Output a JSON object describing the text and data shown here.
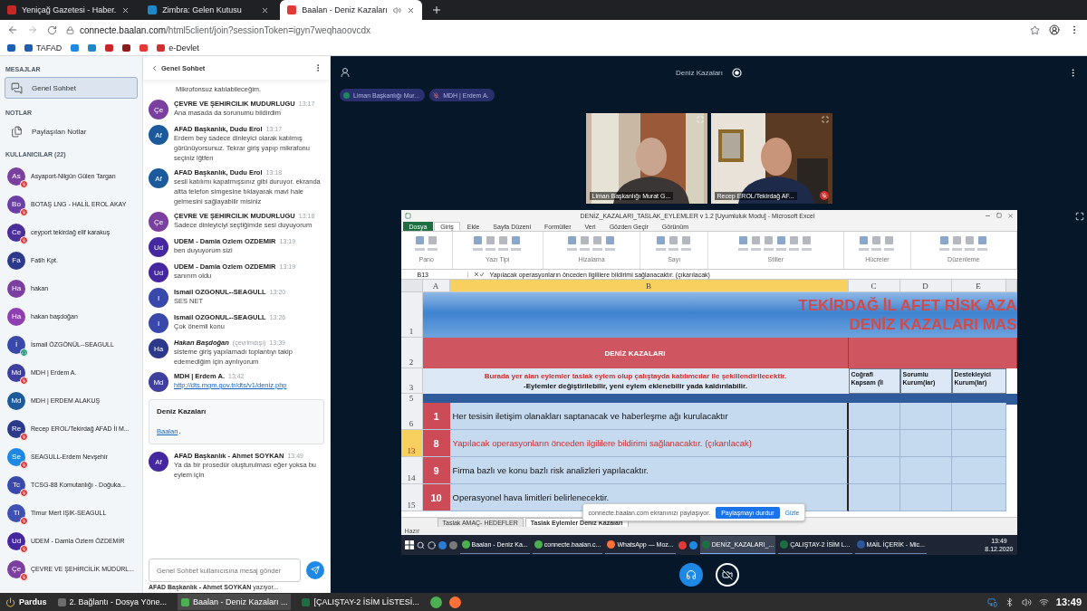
{
  "browser": {
    "tabs": [
      {
        "title": "Yeniçağ Gazetesi - Haber.",
        "color": "#c62828",
        "selected": false,
        "audible": false
      },
      {
        "title": "Zimbra: Gelen Kutusu",
        "color": "#1e88c8",
        "selected": false,
        "audible": false
      },
      {
        "title": "Baalan - Deniz Kazaları",
        "color": "#e53935",
        "selected": true,
        "audible": true
      }
    ],
    "url_host": "connecte.baalan.com",
    "url_path": "/html5client/join?sessionToken=igyn7weqhaoovcdx",
    "bookmarks": [
      {
        "kind": "icon",
        "color": "#1e5fb4"
      },
      {
        "kind": "labeled",
        "label": "TAFAD",
        "color": "#1e5fb4"
      },
      {
        "kind": "icon",
        "color": "#1e88e5"
      },
      {
        "kind": "icon",
        "color": "#1e88c8"
      },
      {
        "kind": "icon",
        "color": "#c62828"
      },
      {
        "kind": "icon",
        "color": "#8e1b1b"
      },
      {
        "kind": "icon",
        "color": "#e53935"
      },
      {
        "kind": "labeled",
        "label": "e-Devlet",
        "color": "#d32f2f"
      }
    ]
  },
  "sidebar": {
    "messages_label": "MESAJLAR",
    "chat_item": {
      "label": "Genel Sohbet",
      "selected": true
    },
    "notes_label": "NOTLAR",
    "notes_item": {
      "label": "Paylaşılan Notlar"
    },
    "users_label": "KULLANICILAR (22)",
    "users": [
      {
        "initials": "As",
        "color": "#7b3fa0",
        "name": "Asyaport-Nilgün Gülen Targan",
        "muted": true,
        "listen_only": false
      },
      {
        "initials": "Bo",
        "color": "#6a3fa6",
        "name": "BOTAŞ LNG - HALİL EROL AKAY",
        "muted": true,
        "listen_only": false
      },
      {
        "initials": "Ce",
        "color": "#4a2f9a",
        "name": "ceyport tekirdağ elif karakuş",
        "muted": true,
        "listen_only": false
      },
      {
        "initials": "Fa",
        "color": "#2d3a8c",
        "name": "Fatih Kpt.",
        "muted": false,
        "listen_only": false
      },
      {
        "initials": "Ha",
        "color": "#7b3fa0",
        "name": "hakan",
        "muted": false,
        "listen_only": false
      },
      {
        "initials": "Ha",
        "color": "#8e3fb0",
        "name": "hakan başdoğan",
        "muted": false,
        "listen_only": false
      },
      {
        "initials": "İ",
        "color": "#3949ab",
        "name": "İsmail ÖZGÖNÜL--SEAGULL",
        "muted": false,
        "listen_only": true
      },
      {
        "initials": "Md",
        "color": "#3f3fa0",
        "name": "MDH | Erdem A.",
        "muted": true,
        "listen_only": false
      },
      {
        "initials": "Md",
        "color": "#1c5a9c",
        "name": "MDH | ERDEM ALAKUŞ",
        "muted": false,
        "listen_only": false
      },
      {
        "initials": "Re",
        "color": "#2c3a8c",
        "name": "Recep EROL/Tekirdağ AFAD İl M...",
        "muted": true,
        "listen_only": false
      },
      {
        "initials": "Se",
        "color": "#1e88e5",
        "name": "SEAGULL-Erdem Nevşehir",
        "muted": true,
        "listen_only": false
      },
      {
        "initials": "Tc",
        "color": "#3949ab",
        "name": "TCSG-88 Komutanlığı - Doğuka...",
        "muted": true,
        "listen_only": false
      },
      {
        "initials": "Ti",
        "color": "#3f51b5",
        "name": "Timur Mert IŞIK-SEAGULL",
        "muted": true,
        "listen_only": false
      },
      {
        "initials": "Ud",
        "color": "#4527a0",
        "name": "UDEM - Damla Özlem ÖZDEMİR",
        "muted": true,
        "listen_only": false
      },
      {
        "initials": "Çe",
        "color": "#7b3fa0",
        "name": "ÇEVRE VE ŞEHİRCİLİK MÜDÜRL...",
        "muted": true,
        "listen_only": false
      }
    ]
  },
  "chat": {
    "title": "Genel Sohbet",
    "messages": [
      {
        "kind": "continued",
        "text": "Mikrofonsuz katılabileceğim."
      },
      {
        "kind": "text",
        "initials": "Çe",
        "color": "#7b3fa0",
        "sender": "ÇEVRE VE ŞEHIRCILIK MUDURLUGU",
        "time": "13:17",
        "text": "Ana masada da sorunumu bildirdim"
      },
      {
        "kind": "text",
        "initials": "Af",
        "color": "#1c5a9c",
        "sender": "AFAD Başkanlık, Dudu Erol",
        "time": "13:17",
        "text": "Erdem bey sadece dinleyici olarak katılmış görünüyorsunuz. Tekrar giriş yapıp mikrafonu seçiniz lğtfen"
      },
      {
        "kind": "text",
        "initials": "Af",
        "color": "#1c5a9c",
        "sender": "AFAD Başkanlık, Dudu Erol",
        "time": "13:18",
        "text": "sesli katılımı kapatmışsınız gibi duruyor. ekranda altta telefon simgesine tıklayarak mavi hale gelmesini sağlayabilir misiniz"
      },
      {
        "kind": "text",
        "initials": "Çe",
        "color": "#7b3fa0",
        "sender": "ÇEVRE VE ŞEHIRCILIK MUDURLUGU",
        "time": "13:18",
        "text": "Sadece dinleyiciyi seçtiğimde sesi duyuyorum"
      },
      {
        "kind": "text",
        "initials": "Ud",
        "color": "#4527a0",
        "sender": "UDEM - Damla Ozlem OZDEMIR",
        "time": "13:19",
        "text": "ben duyuyorum sizi"
      },
      {
        "kind": "text",
        "initials": "Ud",
        "color": "#4527a0",
        "sender": "UDEM - Damla Ozlem OZDEMIR",
        "time": "13:19",
        "text": "sanırım oldu"
      },
      {
        "kind": "text",
        "initials": "I",
        "color": "#3949ab",
        "sender": "Ismail OZGONUL--SEAGULL",
        "time": "13:20",
        "text": "SES NET"
      },
      {
        "kind": "text",
        "initials": "I",
        "color": "#3949ab",
        "sender": "Ismail OZGONUL--SEAGULL",
        "time": "13:26",
        "text": "Çok önemli konu"
      },
      {
        "kind": "text",
        "initials": "Ha",
        "color": "#2d3a8c",
        "sender": "Hakan Başdoğan",
        "offline": true,
        "status": "(çevrimdışı)",
        "time": "13:39",
        "text": "sisteme giriş yapılamadı toplantıyı takip edemediğim için ayrılıyorum"
      },
      {
        "kind": "link",
        "initials": "Md",
        "color": "#3f3fa0",
        "sender": "MDH | Erdem A.",
        "time": "13:42",
        "text": "http://dts.mgm.gov.tr/dts/v1/deniz.php"
      },
      {
        "kind": "card",
        "title": "Deniz Kazaları",
        "link": "Baalan",
        "suffix": "."
      },
      {
        "kind": "text",
        "initials": "Af",
        "color": "#4527a0",
        "sender": "AFAD Başkanlık - Ahmet SOYKAN",
        "time": "13:49",
        "text": "Ya da bir prosedür oluşturulması eğer yoksa bu eylem için"
      }
    ],
    "input_placeholder": "Genel Sohbet kullanıcısına mesaj gönder",
    "typing": "**AFAD Başkanlık - Ahmet SOYKAN** yazıyor..."
  },
  "meeting": {
    "title": "Deniz Kazaları",
    "recording": true,
    "talkers": [
      {
        "name": "Liman Başkanlığı Mur...",
        "talking": true
      },
      {
        "name": "MDH | Erdem A.",
        "talking": false
      }
    ],
    "videos": [
      {
        "name": "Liman Başkanlığı Murat G...",
        "muted": false
      },
      {
        "name": "Recep EROL/Tekirdağ AF...",
        "muted": true
      }
    ],
    "controls": [
      {
        "kind": "audio",
        "active": true
      },
      {
        "kind": "video",
        "active": false
      }
    ]
  },
  "excel": {
    "title": "DENİZ_KAZALARI_TASLAK_EYLEMLER v 1.2  [Uyumluluk Modu]  -  Microsoft Excel",
    "menu_tabs": [
      {
        "label": "Dosya",
        "kind": "file",
        "selected": false
      },
      {
        "label": "Giriş",
        "kind": "tab",
        "selected": true
      },
      {
        "label": "Ekle",
        "kind": "tab",
        "selected": false
      },
      {
        "label": "Sayfa Düzeni",
        "kind": "tab",
        "selected": false
      },
      {
        "label": "Formüller",
        "kind": "tab",
        "selected": false
      },
      {
        "label": "Veri",
        "kind": "tab",
        "selected": false
      },
      {
        "label": "Gözden Geçir",
        "kind": "tab",
        "selected": false
      },
      {
        "label": "Görünüm",
        "kind": "tab",
        "selected": false
      }
    ],
    "ribbon_groups": [
      {
        "label": "Pano"
      },
      {
        "label": "Yazı Tipi"
      },
      {
        "label": "Hizalama"
      },
      {
        "label": "Sayı"
      },
      {
        "label": "Stiller"
      },
      {
        "label": "Hücreler"
      },
      {
        "label": "Düzenleme"
      }
    ],
    "name_box": "B13",
    "formula": "Yapılacak operasyonların önceden ilgililere bildirimi sağlanacaktır. (çıkarılacak)",
    "columns": [
      {
        "label": "A",
        "selected": false
      },
      {
        "label": "B",
        "selected": true
      },
      {
        "label": "C",
        "selected": false
      },
      {
        "label": "D",
        "selected": false
      },
      {
        "label": "E",
        "selected": false
      }
    ],
    "rows": [
      {
        "kind": "title",
        "number": "1",
        "lines": [
          "TEKİRDAĞ İL AFET RİSK AZA",
          "DENİZ KAZALARI MAS"
        ]
      },
      {
        "kind": "section",
        "number": "2",
        "text": "DENİZ KAZALARI"
      },
      {
        "kind": "note",
        "number": "3",
        "lines": [
          "Burada yer alan eylemler taslak eylem olup çalıştayda katılımcılar ile şekillendirilecektir.",
          "-Eylemler değiştirilebilir, yeni eylem eklenebilir yada kaldırılabilir."
        ],
        "headers": [
          "Coğrafi Kapsam (İl",
          "Sorumlu Kurum(lar)",
          "Destekleyici Kurum(lar)"
        ]
      },
      {
        "kind": "band",
        "number": "5"
      },
      {
        "kind": "action",
        "number": "6",
        "index": "1",
        "text": "Her tesisin iletişim olanakları saptanacak ve haberleşme ağı kurulacaktır",
        "selected": false,
        "flagged": false
      },
      {
        "kind": "action",
        "number": "13",
        "index": "8",
        "text": "Yapılacak operasyonların önceden ilgililere bildirimi sağlanacaktır. (çıkarılacak)",
        "selected": true,
        "flagged": true
      },
      {
        "kind": "action",
        "number": "14",
        "index": "9",
        "text": "Firma bazlı ve konu bazlı risk analizleri yapılacaktır.",
        "selected": false,
        "flagged": false
      },
      {
        "kind": "action",
        "number": "15",
        "index": "10",
        "text": "Operasyonel hava limitleri belirlenecektir.",
        "selected": false,
        "flagged": false
      }
    ],
    "sheets": [
      {
        "label": "Taslak AMAÇ- HEDEFLER",
        "selected": false
      },
      {
        "label": "Taslak Eylemler Deniz Kazaları",
        "selected": true
      }
    ],
    "status": "Hazır",
    "share_notice": {
      "text": "connecte.baalan.com ekranınızı paylaşıyor.",
      "stop": "Paylaşmayı durdur",
      "hide": "Gizle"
    },
    "taskbar": {
      "apps": [
        {
          "color": "#2b7cd3"
        },
        {
          "color": "#7a7a7a"
        },
        {
          "label": "Baalan - Deniz Ka...",
          "color": "#4caf50",
          "selected": false
        },
        {
          "label": "connecte.baalan.c...",
          "color": "#4caf50",
          "selected": false
        },
        {
          "label": "WhatsApp — Moz...",
          "color": "#ff7139",
          "selected": false
        },
        {
          "color": "#e53935"
        },
        {
          "color": "#1e88e5"
        },
        {
          "label": "DENİZ_KAZALARI_...",
          "color": "#1d6f42",
          "selected": true
        },
        {
          "label": "ÇALIŞTAY-2 İSİM L...",
          "color": "#1d6f42",
          "selected": false
        },
        {
          "label": "MAİL İÇERİK - Mic...",
          "color": "#2b579a",
          "selected": false
        }
      ],
      "time": "13:49",
      "date": "8.12.2020"
    }
  },
  "taskbar": {
    "start": "Pardus",
    "windows": [
      {
        "label": "2. Bağlantı - Dosya Yöne...",
        "color": "#6d6d6d",
        "selected": false
      },
      {
        "label": "Baalan - Deniz Kazaları ...",
        "color": "#4caf50",
        "selected": true
      },
      {
        "label": "[ÇALIŞTAY-2 İSİM LİSTESİ...",
        "color": "#1d6f42",
        "selected": false
      }
    ],
    "launchers": [
      {
        "color": "#4caf50"
      },
      {
        "color": "#ff7139"
      }
    ],
    "time": "13:49"
  }
}
